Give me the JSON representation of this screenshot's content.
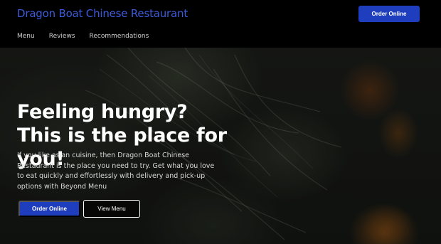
{
  "header": {
    "brand": "Dragon Boat Chinese Restaurant",
    "order_button": "Order Online"
  },
  "nav": {
    "items": [
      {
        "label": "Menu"
      },
      {
        "label": "Reviews"
      },
      {
        "label": "Recommendations"
      }
    ]
  },
  "hero": {
    "title": "Feeling hungry? This is the place for you!",
    "description": "If you like asian cuisine, then Dragon Boat Chinese Restaurant is the place you need to try. Get what you love to eat quickly and effortlessly with delivery and pick-up options with Beyond Menu",
    "order_button": "Order Online",
    "menu_button": "View Menu"
  },
  "colors": {
    "accent": "#1e3ebd",
    "brand_text": "#3d5bd9",
    "background": "#000000"
  }
}
